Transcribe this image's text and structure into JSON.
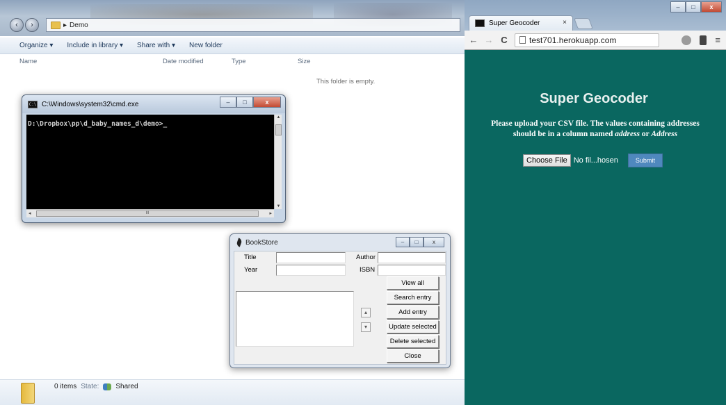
{
  "explorer": {
    "breadcrumb": "Demo",
    "breadcrumb_arrow": "▸",
    "toolbar": [
      "Organize ▾",
      "Include in library ▾",
      "Share with ▾",
      "New folder"
    ],
    "columns": {
      "name": "Name",
      "date_modified": "Date modified",
      "type": "Type",
      "size": "Size"
    },
    "empty_message": "This folder is empty.",
    "status": {
      "items": "0 items",
      "state_label": "State:",
      "state_value": "Shared"
    }
  },
  "cmd": {
    "title": "C:\\Windows\\system32\\cmd.exe",
    "prompt": "D:\\Dropbox\\pp\\d_baby_names_d\\demo>_",
    "hscroll_grip": "III"
  },
  "bookstore": {
    "title": "BookStore",
    "labels": {
      "title": "Title",
      "author": "Author",
      "year": "Year",
      "isbn": "ISBN"
    },
    "buttons": [
      "View all",
      "Search entry",
      "Add entry",
      "Update selected",
      "Delete selected",
      "Close"
    ]
  },
  "chrome": {
    "tab_title": "Super Geocoder",
    "tab_close": "×",
    "url": "test701.herokuapp.com",
    "page": {
      "heading": "Super Geocoder",
      "instruction_1": "Please upload your CSV file. The values containing addresses",
      "instruction_2a": "should be in a column named ",
      "instruction_2b": "address",
      "instruction_2c": " or ",
      "instruction_2d": "Address",
      "choose_file": "Choose File",
      "file_status": "No fil...hosen",
      "submit": "Submit"
    },
    "colors": {
      "page_bg": "#0a6760",
      "submit_bg": "#4f88be"
    }
  },
  "window_controls": {
    "minimize": "–",
    "maximize": "□",
    "close": "x"
  },
  "icons": {
    "back": "←",
    "forward": "→",
    "reload": "C",
    "menu": "≡"
  }
}
